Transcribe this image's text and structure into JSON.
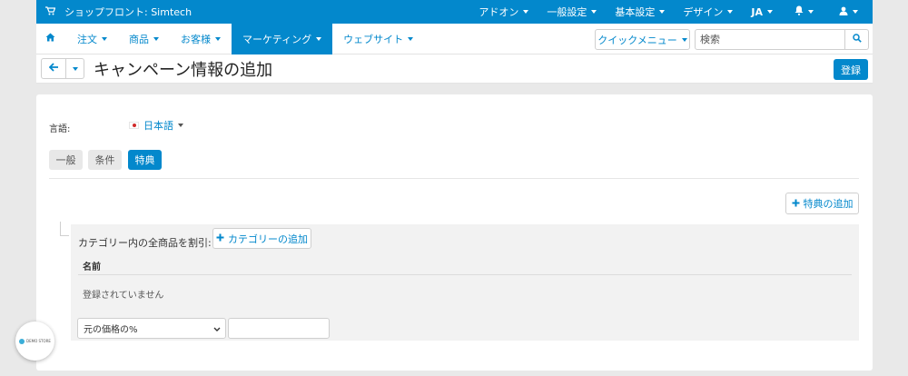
{
  "topbar": {
    "store_title": "ショップフロント: Simtech",
    "menus": [
      {
        "label": "アドオン"
      },
      {
        "label": "一般設定"
      },
      {
        "label": "基本設定"
      },
      {
        "label": "デザイン"
      },
      {
        "label": "JA"
      }
    ]
  },
  "nav": {
    "items": [
      {
        "label": "注文"
      },
      {
        "label": "商品"
      },
      {
        "label": "お客様"
      },
      {
        "label": "マーケティング"
      },
      {
        "label": "ウェブサイト"
      }
    ],
    "quick_menu_label": "クイックメニュー",
    "search_placeholder": "検索"
  },
  "titlebar": {
    "title": "キャンペーン情報の追加",
    "save_label": "登録"
  },
  "form": {
    "language_label": "言語:",
    "language_value": "日本語",
    "tabs": [
      {
        "label": "一般"
      },
      {
        "label": "条件"
      },
      {
        "label": "特典"
      }
    ],
    "active_tab": "特典",
    "add_bonus_label": "特典の追加",
    "bonus": {
      "label": "カテゴリー内の全商品を割引:",
      "add_category_label": "カテゴリーの追加",
      "column_name": "名前",
      "empty_text": "登録されていません",
      "discount_type_value": "元の価格の%",
      "discount_value": ""
    }
  },
  "badge": {
    "text": "DEMO STORE"
  },
  "colors": {
    "accent": "#0388cc",
    "background": "#e9e9e9"
  }
}
